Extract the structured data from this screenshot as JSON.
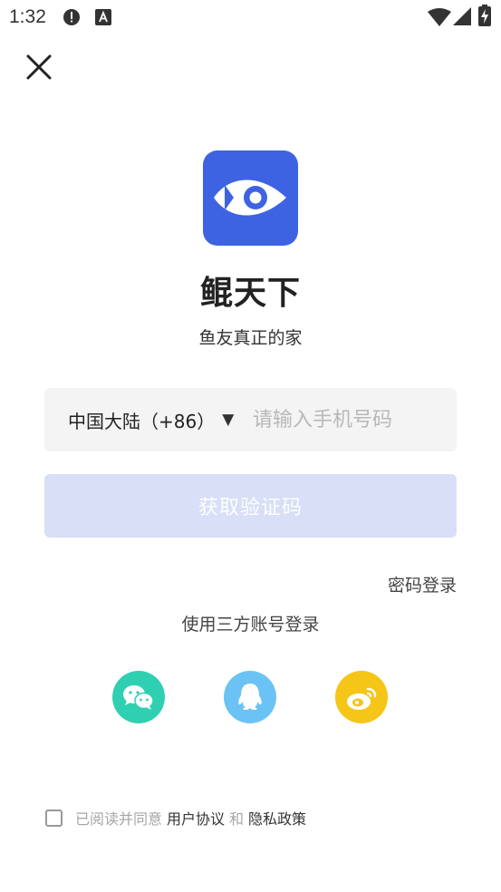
{
  "status_bar": {
    "time": "1:32",
    "left_icons": [
      "alert-icon",
      "a-badge-icon"
    ],
    "right_icons": [
      "wifi-icon",
      "signal-icon",
      "battery-charging-icon"
    ]
  },
  "close_icon": "close-icon",
  "app": {
    "logo_icon": "fish-eye-logo-icon",
    "name": "鲲天下",
    "slogan": "鱼友真正的家",
    "brand_color": "#3d63e3"
  },
  "login_form": {
    "country_code": "中国大陆（+86）",
    "phone_placeholder": "请输入手机号码",
    "phone_value": "",
    "get_code_button": "获取验证码",
    "password_login": "密码登录"
  },
  "third_party": {
    "title": "使用三方账号登录",
    "providers": [
      {
        "name": "wechat",
        "icon": "wechat-icon",
        "color": "#2fd0b1"
      },
      {
        "name": "qq",
        "icon": "qq-icon",
        "color": "#6bc3f5"
      },
      {
        "name": "weibo",
        "icon": "weibo-icon",
        "color": "#f5c518"
      }
    ]
  },
  "agreement": {
    "prefix": "已阅读并同意",
    "user_agreement": "用户协议",
    "and": "和",
    "privacy_policy": "隐私政策",
    "checked": false
  }
}
